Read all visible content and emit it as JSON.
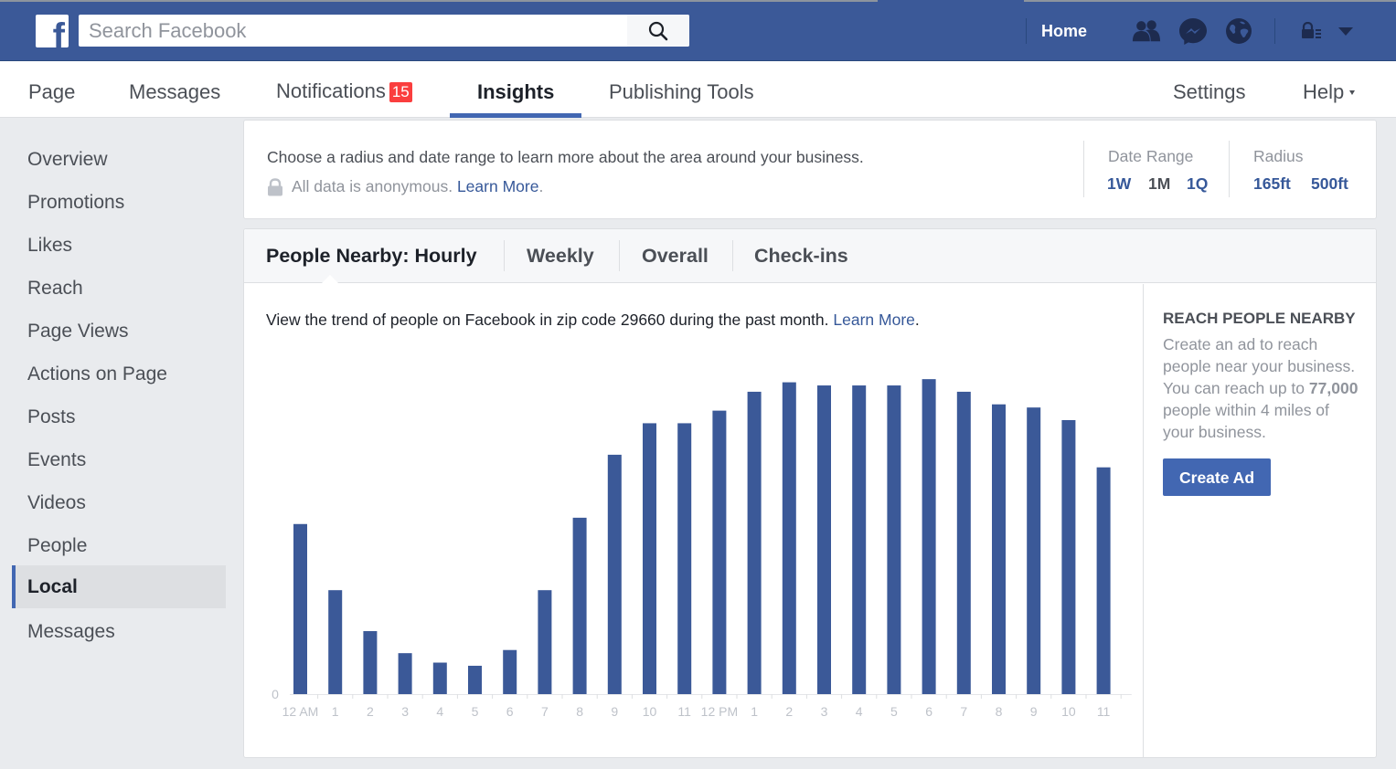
{
  "topbar": {
    "logo_letter": "f",
    "search_placeholder": "Search Facebook",
    "search_value": "",
    "home_label": "Home",
    "icons": [
      "friends-icon",
      "messenger-icon",
      "notifications-globe-icon",
      "privacy-shortcuts-icon",
      "account-menu-caret-icon"
    ]
  },
  "pagenav": {
    "tabs": [
      {
        "label": "Page"
      },
      {
        "label": "Messages"
      },
      {
        "label": "Notifications",
        "badge": "15"
      },
      {
        "label": "Insights",
        "active": true
      },
      {
        "label": "Publishing Tools"
      }
    ],
    "settings_label": "Settings",
    "help_label": "Help"
  },
  "sidebar": {
    "items": [
      {
        "label": "Overview"
      },
      {
        "label": "Promotions"
      },
      {
        "label": "Likes"
      },
      {
        "label": "Reach"
      },
      {
        "label": "Page Views"
      },
      {
        "label": "Actions on Page"
      },
      {
        "label": "Posts"
      },
      {
        "label": "Events"
      },
      {
        "label": "Videos"
      },
      {
        "label": "People"
      },
      {
        "label": "Local",
        "active": true
      },
      {
        "label": "Messages"
      }
    ]
  },
  "info": {
    "line1": "Choose a radius and date range to learn more about the area around your business.",
    "line2": "All data is anonymous.",
    "learn_more": "Learn More",
    "date_range_label": "Date Range",
    "date_options": [
      {
        "label": "1W",
        "selected": false
      },
      {
        "label": "1M",
        "selected": true
      },
      {
        "label": "1Q",
        "selected": false
      }
    ],
    "radius_label": "Radius",
    "radius_options": [
      {
        "label": "165ft"
      },
      {
        "label": "500ft"
      }
    ]
  },
  "main": {
    "tabs": [
      {
        "label": "People Nearby: Hourly",
        "active": true
      },
      {
        "label": "Weekly"
      },
      {
        "label": "Overall"
      },
      {
        "label": "Check-ins"
      }
    ],
    "description": "View the trend of people on Facebook in zip code 29660 during the past month.",
    "learn_more": "Learn More",
    "promo": {
      "title": "REACH PEOPLE NEARBY",
      "text_before": "Create an ad to reach people near your business. You can reach up to ",
      "highlight": "77,000",
      "text_after": " people within 4 miles of your business.",
      "button": "Create Ad"
    }
  },
  "colors": {
    "brand": "#3b5998",
    "accent": "#4267b2",
    "link": "#365899",
    "badge": "#fa3e3e",
    "bar": "#3b5998"
  },
  "chart_data": {
    "type": "bar",
    "title": "",
    "xlabel": "",
    "ylabel": "",
    "y_tick_labels": [
      "0"
    ],
    "ylim": [
      0,
      107
    ],
    "value_units": "relative to peak hour (peak = 100)",
    "grid": false,
    "legend": "none",
    "categories": [
      "12 AM",
      "1",
      "2",
      "3",
      "4",
      "5",
      "6",
      "7",
      "8",
      "9",
      "10",
      "11",
      "12 PM",
      "1",
      "2",
      "3",
      "4",
      "5",
      "6",
      "7",
      "8",
      "9",
      "10",
      "11"
    ],
    "values": [
      54,
      33,
      20,
      13,
      10,
      9,
      14,
      33,
      56,
      76,
      86,
      86,
      90,
      96,
      99,
      98,
      98,
      98,
      100,
      96,
      92,
      91,
      87,
      72
    ]
  }
}
